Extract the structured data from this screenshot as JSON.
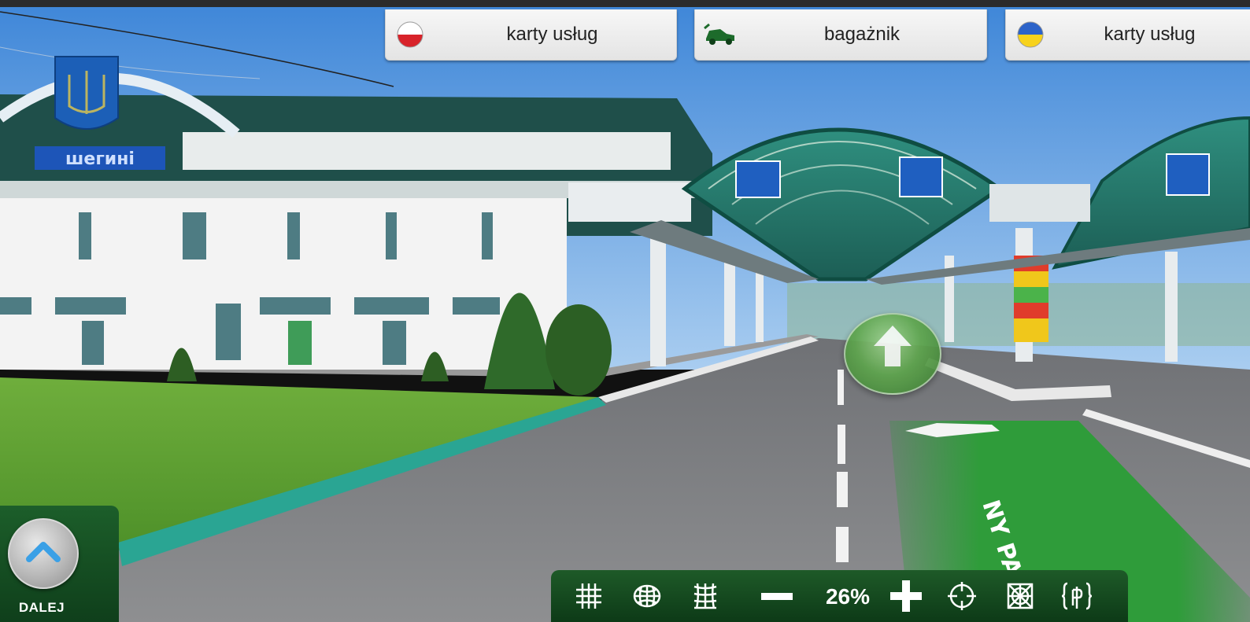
{
  "tabs": [
    {
      "label": "karty usług",
      "flag": "poland-flag-icon"
    },
    {
      "label": "bagażnik",
      "icon": "vehicle-icon"
    },
    {
      "label": "karty usług",
      "flag": "ukraine-flag-icon"
    }
  ],
  "scene": {
    "building_sign": "шегині",
    "road_marking": "NY PAS"
  },
  "navigation": {
    "forward_icon": "forward-arrow-icon",
    "dalej_label": "DALEJ",
    "dalej_icon": "chevron-up-icon"
  },
  "toolbar": {
    "zoom_level": "26%",
    "buttons": [
      "grid-icon",
      "sphere-icon",
      "warp-grid-icon",
      "zoom-out-icon",
      "zoom-in-icon",
      "target-icon",
      "fisheye-icon",
      "fit-icon"
    ]
  },
  "colors": {
    "toolbar_green": "#14471f",
    "arrow_green": "#5ea54d",
    "tab_bg": "#eeeeee",
    "sky": "#5b9be0"
  }
}
